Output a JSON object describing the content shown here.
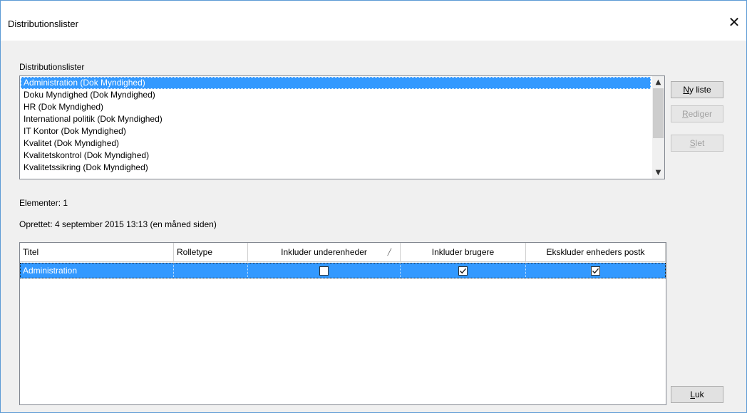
{
  "window": {
    "title": "Distributionslister",
    "close_icon": "close-icon"
  },
  "lists": {
    "group_label": "Distributionslister",
    "items": [
      {
        "label": "Administration (Dok Myndighed)",
        "selected": true
      },
      {
        "label": "Doku Myndighed (Dok Myndighed)",
        "selected": false
      },
      {
        "label": "HR (Dok Myndighed)",
        "selected": false
      },
      {
        "label": "International politik (Dok Myndighed)",
        "selected": false
      },
      {
        "label": "IT Kontor (Dok Myndighed)",
        "selected": false
      },
      {
        "label": "Kvalitet (Dok Myndighed)",
        "selected": false
      },
      {
        "label": "Kvalitetskontrol (Dok Myndighed)",
        "selected": false
      },
      {
        "label": "Kvalitetssikring (Dok Myndighed)",
        "selected": false
      }
    ]
  },
  "buttons": {
    "new_list": {
      "mnemonic": "N",
      "rest": "y liste"
    },
    "edit": {
      "mnemonic": "R",
      "rest": "ediger"
    },
    "delete": {
      "mnemonic": "S",
      "rest": "let"
    },
    "close": {
      "mnemonic": "L",
      "rest": "uk"
    }
  },
  "info": {
    "elements": "Elementer: 1",
    "created": "Oprettet: 4 september 2015 13:13 (en måned siden)"
  },
  "grid": {
    "columns": [
      "Titel",
      "Rolletype",
      "Inkluder underenheder",
      "Inkluder brugere",
      "Ekskluder enheders postk"
    ],
    "rows": [
      {
        "title": "Administration",
        "role_type": "",
        "include_subunits": false,
        "include_users": true,
        "exclude_unit_mail": true
      }
    ]
  },
  "colors": {
    "selection": "#3399ff",
    "window_border": "#5d9bd5",
    "dialog_bg": "#f0f0f0"
  }
}
